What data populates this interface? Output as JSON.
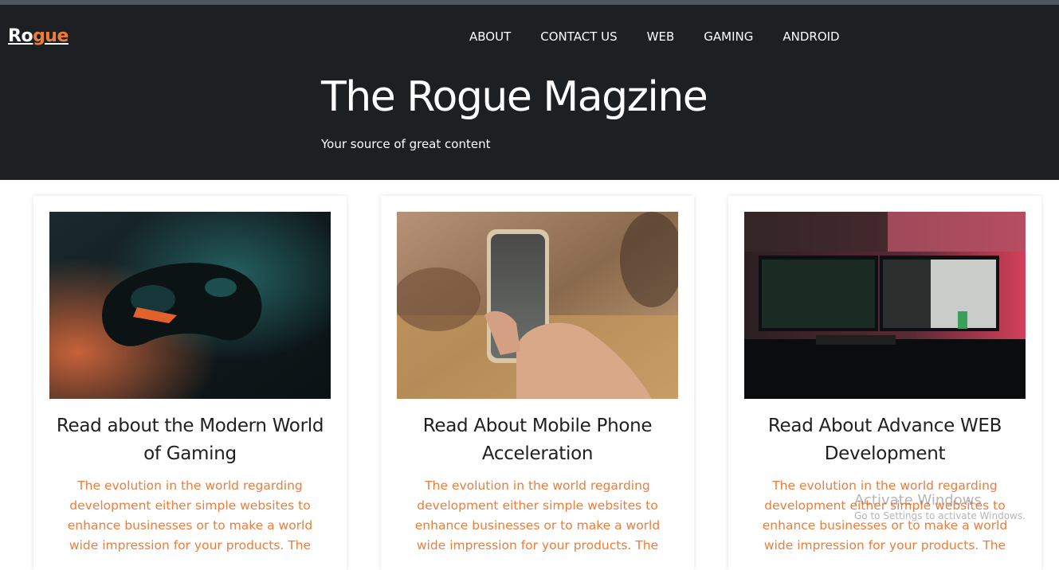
{
  "brand": {
    "logo_part1": "Ro",
    "logo_part2": "gue",
    "accent_color": "#ee7c3a",
    "header_bg": "#1d2023"
  },
  "nav": {
    "items": [
      {
        "label": "ABOUT"
      },
      {
        "label": "CONTACT US"
      },
      {
        "label": "WEB"
      },
      {
        "label": "GAMING"
      },
      {
        "label": "ANDROID"
      }
    ]
  },
  "hero": {
    "title": "The Rogue Magzine",
    "subtitle": "Your source of great content"
  },
  "cards": [
    {
      "image": "gaming-controller-photo",
      "title": "Read about the Modern World of Gaming",
      "description": "The evolution in the world regarding development either simple websites to enhance businesses or to make a world wide impression for your products. The"
    },
    {
      "image": "mobile-phone-in-hand-photo",
      "title": "Read About Mobile Phone Acceleration",
      "description": "The evolution in the world regarding development either simple websites to enhance businesses or to make a world wide impression for your products. The"
    },
    {
      "image": "computer-monitors-code-photo",
      "title": "Read About Advance WEB Development",
      "description": "The evolution in the world regarding development either simple websites to enhance businesses or to make a world wide impression for your products. The"
    }
  ],
  "watermark": {
    "line1": "Activate Windows",
    "line2": "Go to Settings to activate Windows."
  }
}
